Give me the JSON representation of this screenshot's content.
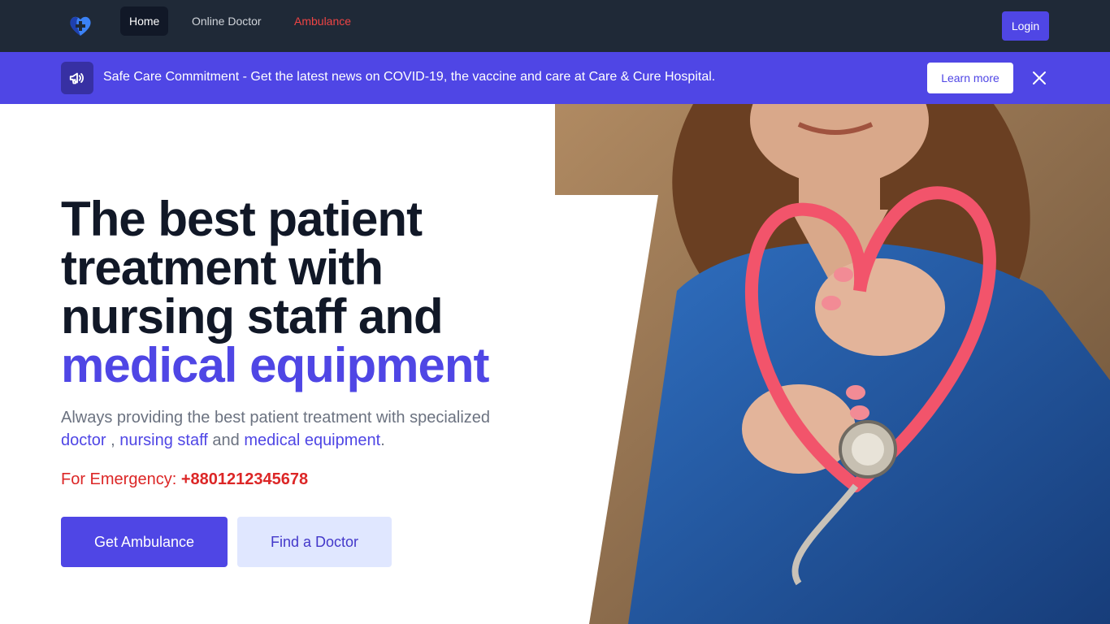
{
  "nav": {
    "logo": "heart-plus-logo",
    "links": [
      {
        "label": "Home",
        "active": true
      },
      {
        "label": "Online Doctor"
      },
      {
        "label": "Ambulance",
        "color": "#ef4444"
      }
    ],
    "login_label": "Login"
  },
  "banner": {
    "icon": "megaphone-icon",
    "text": "Safe Care Commitment - Get the latest news on COVID-19, the vaccine and care at Care & Cure Hospital.",
    "learn_more_label": "Learn more",
    "close_icon": "close-icon"
  },
  "hero": {
    "title_lines": [
      "The best patient",
      "treatment with",
      "nursing staff and"
    ],
    "title_accent": "medical equipment",
    "subtitle_prefix": "Always providing the best patient treatment with specialized",
    "subtitle_link_doctor": "doctor",
    "subtitle_sep1": " , ",
    "subtitle_link_nursing": "nursing staff",
    "subtitle_sep2": " and ",
    "subtitle_link_equipment": "medical equipment",
    "subtitle_end": ".",
    "emergency_label": "For Emergency: ",
    "emergency_number": "+8801212345678",
    "btn_ambulance": "Get Ambulance",
    "btn_doctor": "Find a Doctor"
  },
  "colors": {
    "nav_bg": "#1f2937",
    "accent": "#4f46e5",
    "danger": "#dc2626",
    "ambulance_link": "#ef4444"
  }
}
